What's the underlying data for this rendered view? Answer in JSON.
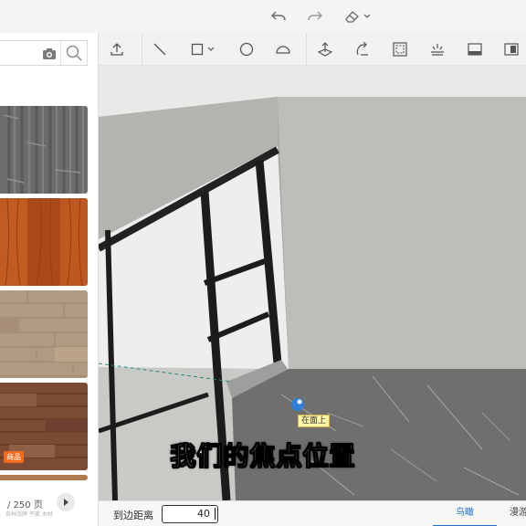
{
  "topbar": {
    "icons": [
      "undo-icon",
      "redo-icon",
      "eraser-icon",
      "chevron-down-icon"
    ]
  },
  "toolbar": {
    "icons": [
      "upload-icon",
      "line-icon",
      "rectangle-icon",
      "chevron-down-icon",
      "circle-icon",
      "arc-icon",
      "push-pull-icon",
      "rotate-icon",
      "offset-icon",
      "floor-light-icon",
      "cabinet-icon",
      "panel-icon"
    ]
  },
  "leftpanel": {
    "search": {
      "placeholder": ""
    },
    "materials": [
      {
        "name": "gray-stone-texture",
        "color": "#6d6d6d",
        "badge": ""
      },
      {
        "name": "orange-wood-texture",
        "color": "#b8521e",
        "badge": ""
      },
      {
        "name": "beige-wood-texture",
        "color": "#b19a82",
        "badge": ""
      },
      {
        "name": "brown-wood-texture",
        "color": "#7d4b32",
        "badge": "商品"
      }
    ],
    "pager": {
      "text": "/ 250 页",
      "subtext": "各种品牌  平面 木材"
    }
  },
  "viewport": {
    "snap_tip": "在面上",
    "subtitle": "我们的焦点位置"
  },
  "bottombar": {
    "label": "到边距离",
    "distance_value": "40",
    "tabs": [
      "鸟瞰",
      "漫游"
    ]
  },
  "colors": {
    "accent": "#1f6fd1",
    "badge": "#f26b1d"
  }
}
